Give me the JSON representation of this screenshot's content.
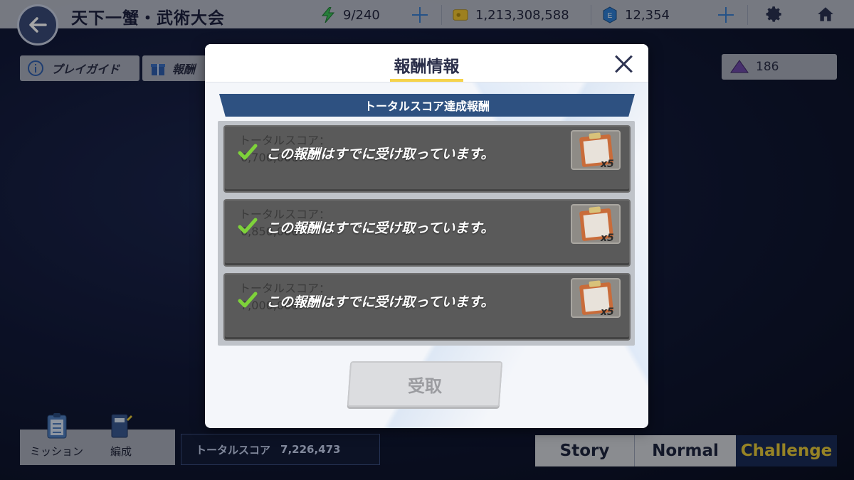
{
  "header": {
    "title": "天下一蟹・武術大会",
    "stamina": "9/240",
    "credits": "1,213,308,588",
    "gems": "12,354"
  },
  "sub_buttons": {
    "play_guide": "プレイガイド",
    "reward_partial": "報酬",
    "item_count": "186"
  },
  "modal": {
    "title": "報酬情報",
    "section_title": "トータルスコア達成報酬",
    "rows": [
      {
        "score_label": "トータルスコア：",
        "score_value": "6,700,000",
        "message": "この報酬はすでに受け取っています。",
        "reward_count": "x5"
      },
      {
        "score_label": "トータルスコア：",
        "score_value": "6,850,000",
        "message": "この報酬はすでに受け取っています。",
        "reward_count": "x5"
      },
      {
        "score_label": "トータルスコア：",
        "score_value": "7,000,000",
        "message": "この報酬はすでに受け取っています。",
        "reward_count": "x5"
      }
    ],
    "receive_button": "受取"
  },
  "bottom": {
    "mission_label": "ミッション",
    "formation_label": "編成",
    "total_score_label": "トータルスコア",
    "total_score_value": "7,226,473",
    "tabs": [
      "Story",
      "Normal",
      "Challenge"
    ],
    "active_tab": "Challenge"
  },
  "colors": {
    "accent_yellow": "#f6d34a",
    "section_blue": "#2e5181",
    "check_green": "#7ed23a",
    "active_tab_text": "#e7c93a"
  }
}
